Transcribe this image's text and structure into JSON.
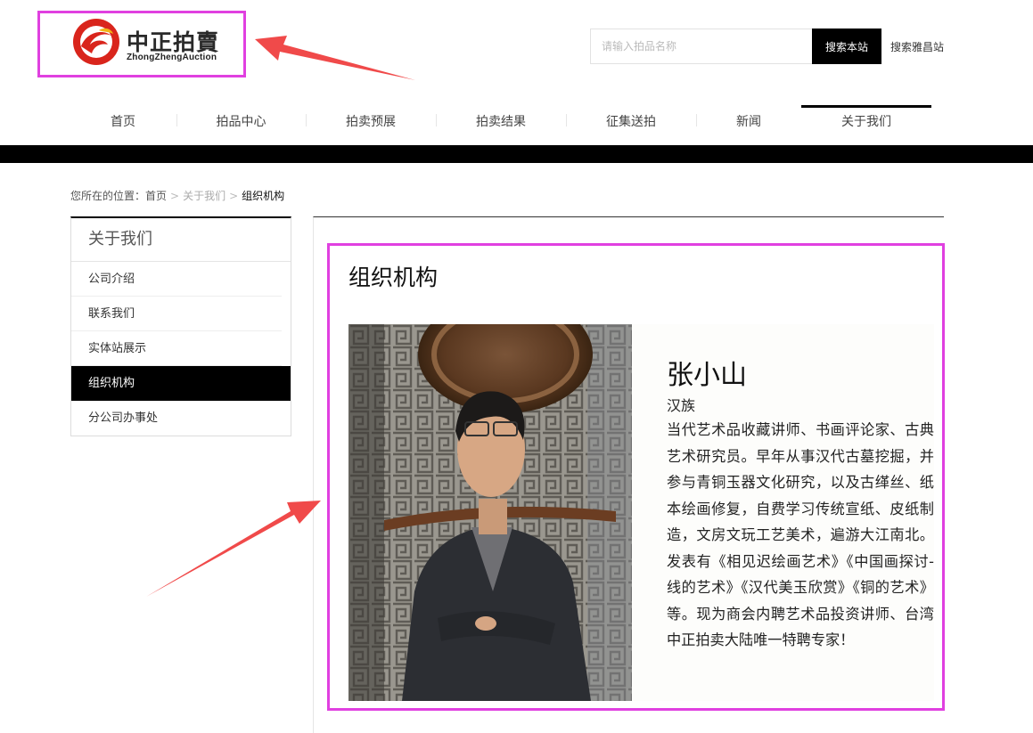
{
  "header": {
    "logo_cn": "中正拍賣",
    "logo_en": "ZhongZhengAuction",
    "search_placeholder": "请输入拍品名称",
    "search_button": "搜索本站",
    "search_alt": "搜索雅昌站"
  },
  "nav": {
    "items": [
      {
        "label": "首页"
      },
      {
        "label": "拍品中心"
      },
      {
        "label": "拍卖预展"
      },
      {
        "label": "拍卖结果"
      },
      {
        "label": "征集送拍"
      },
      {
        "label": "新闻"
      },
      {
        "label": "关于我们",
        "active": true
      }
    ]
  },
  "breadcrumb": {
    "prefix": "您所在的位置：",
    "home": "首页",
    "section": "关于我们",
    "current": "组织机构"
  },
  "sidebar": {
    "title": "关于我们",
    "items": [
      {
        "label": "公司介绍"
      },
      {
        "label": "联系我们"
      },
      {
        "label": "实体站展示"
      },
      {
        "label": "组织机构",
        "active": true
      },
      {
        "label": "分公司办事处"
      }
    ]
  },
  "main": {
    "title": "组织机构",
    "profile": {
      "name": "张小山",
      "ethnicity": "汉族",
      "bio": "当代艺术品收藏讲师、书画评论家、古典艺术研究员。早年从事汉代古墓挖掘，并参与青铜玉器文化研究，以及古缂丝、纸本绘画修复，自费学习传统宣纸、皮纸制造，文房文玩工艺美术，遍游大江南北。发表有《相见迟绘画艺术》《中国画探讨-线的艺术》《汉代美玉欣赏》《铜的艺术》等。现为商会内聘艺术品投资讲师、台湾中正拍卖大陆唯一特聘专家！"
    }
  },
  "colors": {
    "annotation": "#e040e0",
    "arrow": "#f04a4a",
    "logo_red": "#d9251c",
    "black": "#000000"
  }
}
